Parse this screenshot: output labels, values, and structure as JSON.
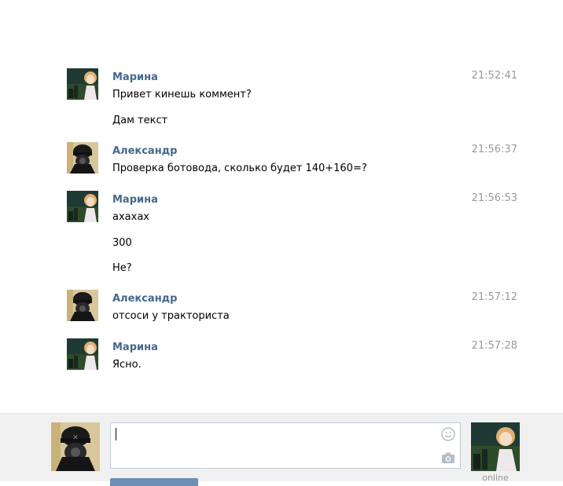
{
  "messages": [
    {
      "author": "Марина",
      "avatar": "marina-avatar",
      "time": "21:52:41",
      "lines": [
        "Привет кинешь коммент?",
        "Дам текст"
      ]
    },
    {
      "author": "Александр",
      "avatar": "aleksandr-avatar",
      "time": "21:56:37",
      "lines": [
        "Проверка ботовода, сколько будет 140+160=?"
      ]
    },
    {
      "author": "Марина",
      "avatar": "marina-avatar",
      "time": "21:56:53",
      "lines": [
        "ахахах",
        "300",
        "Не?"
      ]
    },
    {
      "author": "Александр",
      "avatar": "aleksandr-avatar",
      "time": "21:57:12",
      "lines": [
        "отсоси у тракториста"
      ]
    },
    {
      "author": "Марина",
      "avatar": "marina-avatar",
      "time": "21:57:28",
      "lines": [
        "Ясно."
      ]
    }
  ],
  "composer": {
    "input_value": "",
    "peer_status": "online",
    "icons": [
      "smile-icon",
      "camera-icon"
    ]
  },
  "colors": {
    "author_link": "#45688e",
    "timestamp": "#999999",
    "composer_bg": "#f0f0f0",
    "input_border": "#c0cad5",
    "send_button": "#6d8fb3"
  }
}
